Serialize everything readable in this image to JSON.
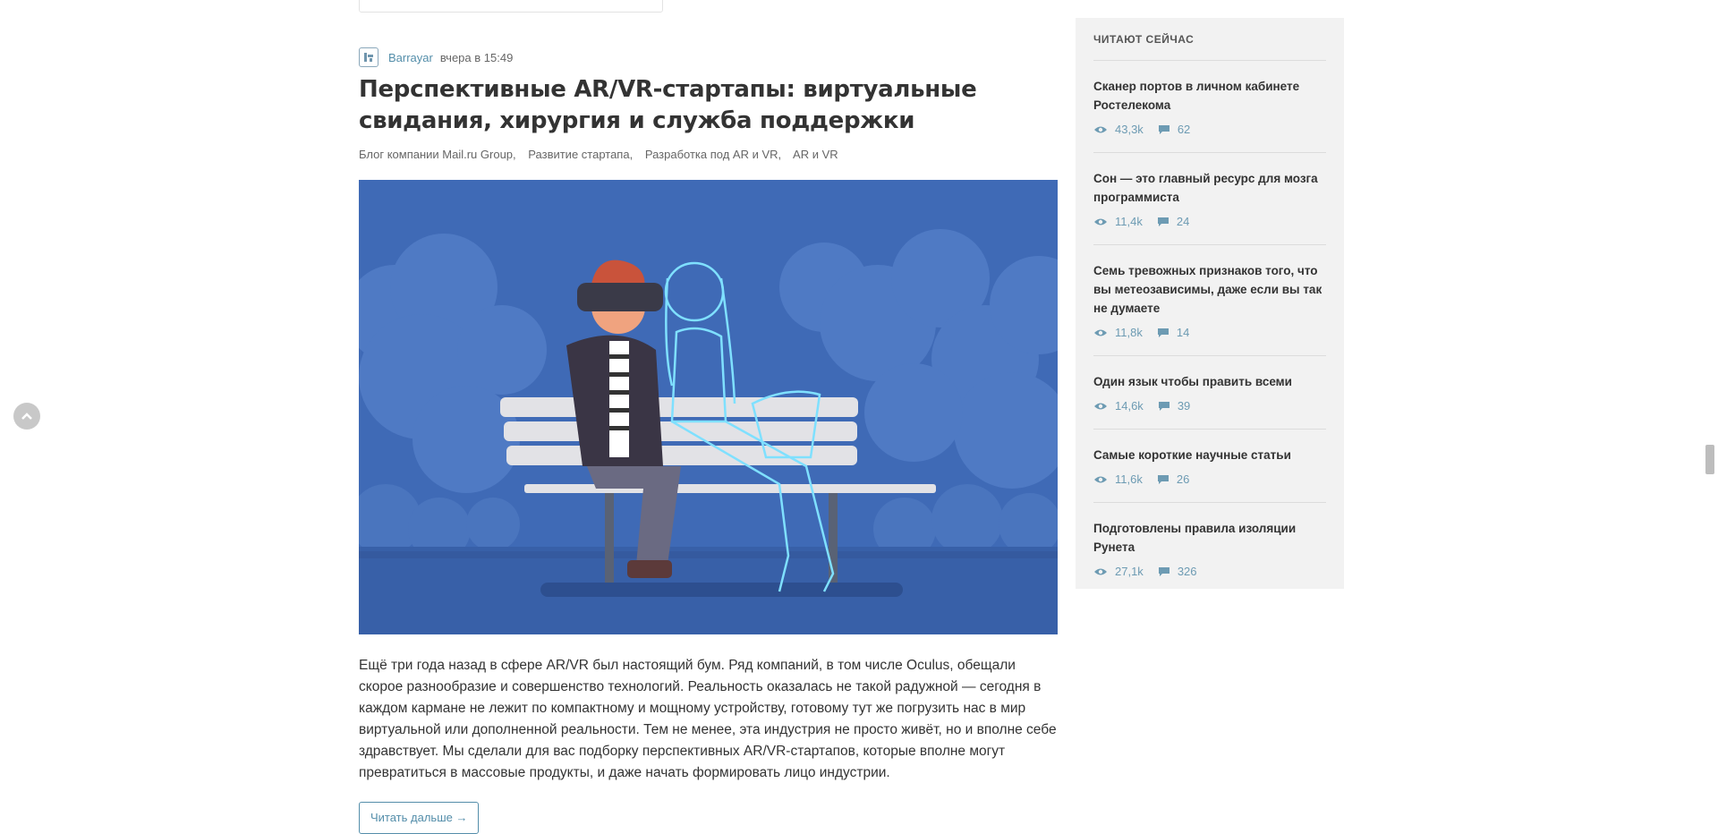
{
  "post": {
    "author": "Barrayar",
    "date": "вчера в 15:49",
    "title": "Перспективные AR/VR-стартапы: виртуальные свидания, хирургия и служба поддержки",
    "hubs": [
      "Блог компании Mail.ru Group,",
      "Развитие стартапа,",
      "Разработка под AR и VR,",
      "AR и VR"
    ],
    "text": "Ещё три года назад в сфере AR/VR был настоящий бум. Ряд компаний, в том числе Oculus, обещали скорое разнообразие и совершенство технологий. Реальность оказалась не такой радужной — сегодня в каждом кармане не лежит по компактному и мощному устройству, готовому тут же погрузить нас в мир виртуальной или дополненной реальности. Тем не менее, эта индустрия не просто живёт, но и вполне себе здравствует. Мы сделали для вас подборку перспективных AR/VR-стартапов, которые вполне могут превратиться в массовые продукты, и даже начать формировать лицо индустрии.",
    "read_more": "Читать дальше →"
  },
  "sidebar": {
    "title": "ЧИТАЮТ СЕЙЧАС",
    "items": [
      {
        "title": "Сканер портов в личном кабинете Ростелекома",
        "views": "43,3k",
        "comments": "62"
      },
      {
        "title": "Сон — это главный ресурс для мозга программиста",
        "views": "11,4k",
        "comments": "24"
      },
      {
        "title": "Семь тревожных признаков того, что вы метеозависимы, даже если вы так не думаете",
        "views": "11,8k",
        "comments": "14"
      },
      {
        "title": "Один язык чтобы править всеми",
        "views": "14,6k",
        "comments": "39"
      },
      {
        "title": "Самые короткие научные статьи",
        "views": "11,6k",
        "comments": "26"
      },
      {
        "title": "Подготовлены правила изоляции Рунета",
        "views": "27,1k",
        "comments": "326"
      }
    ]
  },
  "icons": {
    "views": "eye-icon",
    "comments": "comment-icon",
    "scroll_up": "chevron-up-icon"
  },
  "colors": {
    "link": "#548eaa",
    "image_bg": "#3f6ab6",
    "sidebar_bg": "#f2f2f2"
  }
}
